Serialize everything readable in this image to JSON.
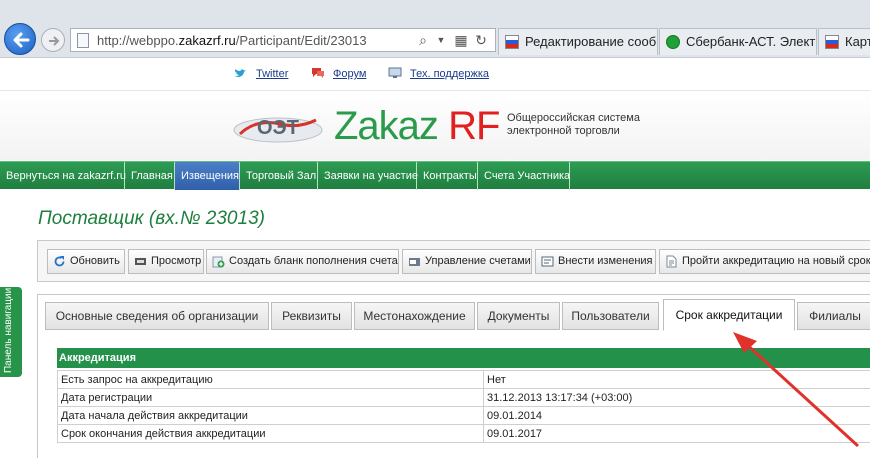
{
  "browser": {
    "url_prefix": "http://webppo.",
    "url_domain": "zakazrf.ru",
    "url_path": "/Participant/Edit/23013",
    "tabs": [
      {
        "label": "Редактирование сооб..."
      },
      {
        "label": "Сбербанк-АСТ. Электр..."
      },
      {
        "label": "Карто"
      }
    ]
  },
  "toplinks": {
    "twitter": "Twitter",
    "forum": "Форум",
    "support": "Тех. поддержка"
  },
  "logo": {
    "oet_text": "ОЭТ",
    "brand_main": "Zakaz",
    "brand_rf": "RF",
    "tagline": "Общероссийская система электронной торговли"
  },
  "nav": [
    {
      "label": "Вернуться на zakazrf.ru"
    },
    {
      "label": "Главная"
    },
    {
      "label": "Извещения"
    },
    {
      "label": "Торговый Зал"
    },
    {
      "label": "Заявки на участие"
    },
    {
      "label": "Контракты"
    },
    {
      "label": "Счета Участника"
    }
  ],
  "side_panel": "Панель навигации",
  "page_title": "Поставщик (вх.№ 23013)",
  "toolbar": [
    {
      "label": "Обновить",
      "icon": "refresh-icon"
    },
    {
      "label": "Просмотр",
      "icon": "view-icon"
    },
    {
      "label": "Создать бланк пополнения счета",
      "icon": "add-icon"
    },
    {
      "label": "Управление счетами",
      "icon": "accounts-icon"
    },
    {
      "label": "Внести изменения",
      "icon": "edit-icon"
    },
    {
      "label": "Пройти аккредитацию на новый срок",
      "icon": "document-icon"
    }
  ],
  "tabs": [
    {
      "label": "Основные сведения об организации"
    },
    {
      "label": "Реквизиты"
    },
    {
      "label": "Местонахождение"
    },
    {
      "label": "Документы"
    },
    {
      "label": "Пользователи"
    },
    {
      "label": "Срок аккредитации"
    },
    {
      "label": "Филиалы"
    }
  ],
  "active_tab": "Срок аккредитации",
  "accreditation": {
    "header": "Аккредитация",
    "rows": [
      {
        "key": "Есть запрос на аккредитацию",
        "value": "Нет"
      },
      {
        "key": "Дата регистрации",
        "value": "31.12.2013 13:17:34 (+03:00)"
      },
      {
        "key": "Дата начала действия аккредитации",
        "value": "09.01.2014"
      },
      {
        "key": "Срок окончания действия аккредитации",
        "value": "09.01.2017"
      }
    ]
  },
  "colors": {
    "brand_green": "#2a9b4a",
    "brand_red": "#e0211f",
    "nav_active": "#3b6cb8",
    "annotation_arrow": "#e0322a"
  }
}
